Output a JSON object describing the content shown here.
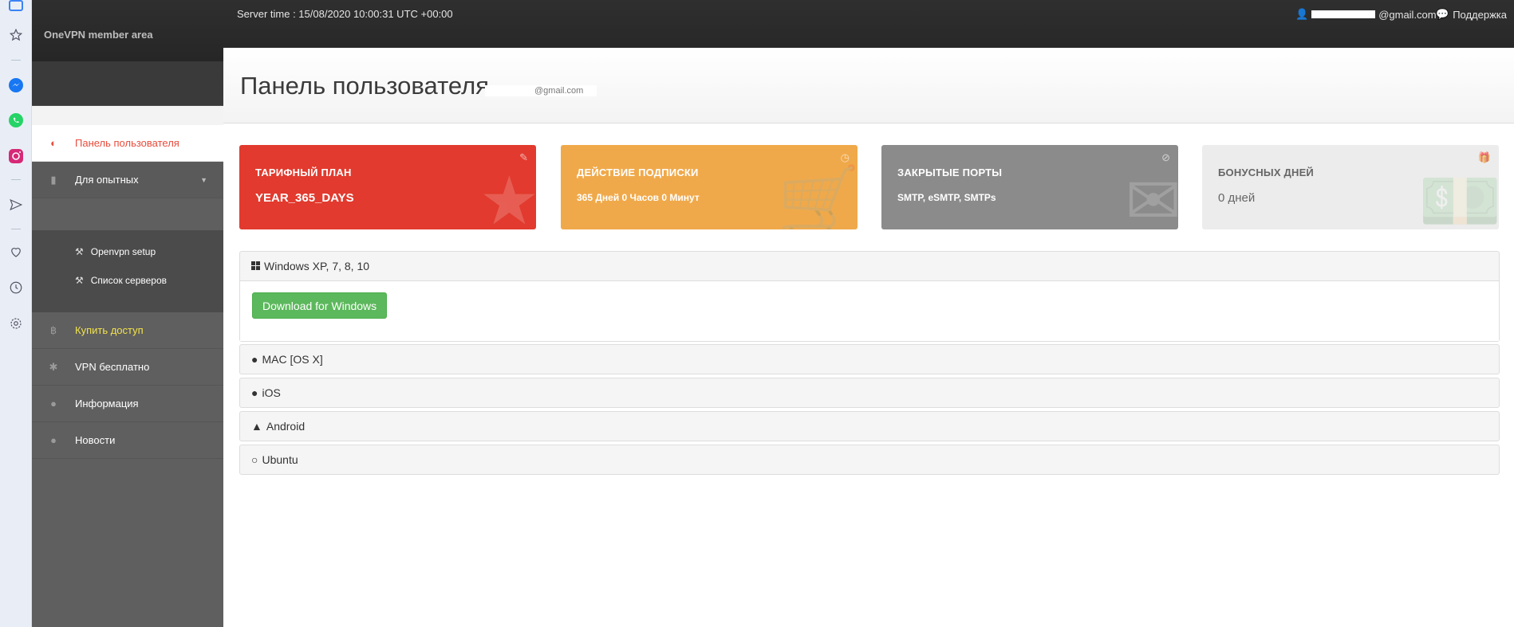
{
  "header": {
    "brand": "OneVPN member area",
    "server_time": "Server time : 15/08/2020 10:00:31 UTC +00:00",
    "user_email_visible": "@gmail.com",
    "support_label": "Поддержка"
  },
  "sidebar": {
    "items": [
      {
        "label": "Панель пользователя",
        "icon": "dashboard-icon"
      },
      {
        "label": "Для опытных",
        "icon": "puzzle-icon"
      },
      {
        "label": "Купить доступ",
        "icon": "bitcoin-icon"
      },
      {
        "label": "VPN бесплатно",
        "icon": "asterisk-icon"
      },
      {
        "label": "Информация",
        "icon": "user-icon"
      },
      {
        "label": "Новости",
        "icon": "user-icon"
      }
    ],
    "submenu": [
      {
        "label": "Openvpn setup",
        "icon": "wrench-icon"
      },
      {
        "label": "Список серверов",
        "icon": "wrench-icon"
      }
    ]
  },
  "page": {
    "title": "Панель пользователя",
    "title_suffix": "@gmail.com"
  },
  "cards": [
    {
      "label": "ТАРИФНЫЙ ПЛАН",
      "value": "YEAR_365_DAYS",
      "color": "#e23a2e"
    },
    {
      "label": "ДЕЙСТВИЕ ПОДПИСКИ",
      "value": "365 Дней 0 Часов 0 Минут",
      "color": "#f0a94a"
    },
    {
      "label": "ЗАКРЫТЫЕ ПОРТЫ",
      "value": "SMTP, eSMTP, SMTPs",
      "color": "#8b8b8b"
    },
    {
      "label": "БОНУСНЫХ ДНЕЙ",
      "value": "0 дней",
      "color": "#ececec"
    }
  ],
  "platforms": [
    {
      "label": "Windows XP, 7, 8, 10",
      "icon": "windows-icon",
      "button": "Download for Windows"
    },
    {
      "label": "MAC [OS X]",
      "icon": "apple-icon"
    },
    {
      "label": "iOS",
      "icon": "apple-icon"
    },
    {
      "label": "Android",
      "icon": "android-icon"
    },
    {
      "label": "Ubuntu",
      "icon": "linux-icon"
    }
  ]
}
